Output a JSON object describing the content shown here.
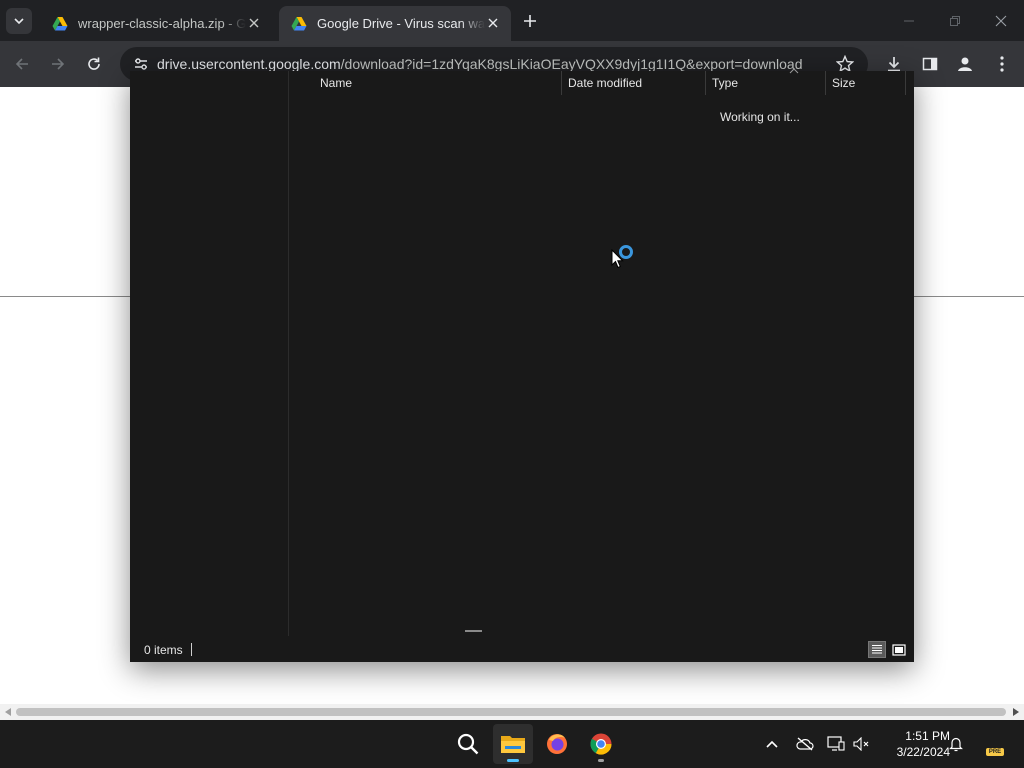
{
  "browser": {
    "tabs": [
      {
        "title": "wrapper-classic-alpha.zip - Google Drive",
        "active": false
      },
      {
        "title": "Google Drive - Virus scan warning",
        "active": true
      }
    ],
    "omnibox": {
      "host": "drive.usercontent.google.com",
      "path": "/download?id=1zdYqaK8gsLiKiaOEayVQXX9dyj1g1I1Q&export=download"
    }
  },
  "dialog": {
    "columns": {
      "name": "Name",
      "date_modified": "Date modified",
      "type": "Type",
      "size": "Size"
    },
    "working_text": "Working on it...",
    "status_items": "0 items"
  },
  "taskbar": {
    "apps": [
      "search",
      "file-explorer",
      "firefox",
      "chrome"
    ],
    "time": "1:51 PM",
    "date": "3/22/2024",
    "badge": "PRE"
  },
  "colors": {
    "chrome_dark": "#202124",
    "toolbar": "#35363a",
    "dialog_bg": "#191919",
    "accent": "#3a96dd",
    "taskbar": "#1c1c1c"
  }
}
